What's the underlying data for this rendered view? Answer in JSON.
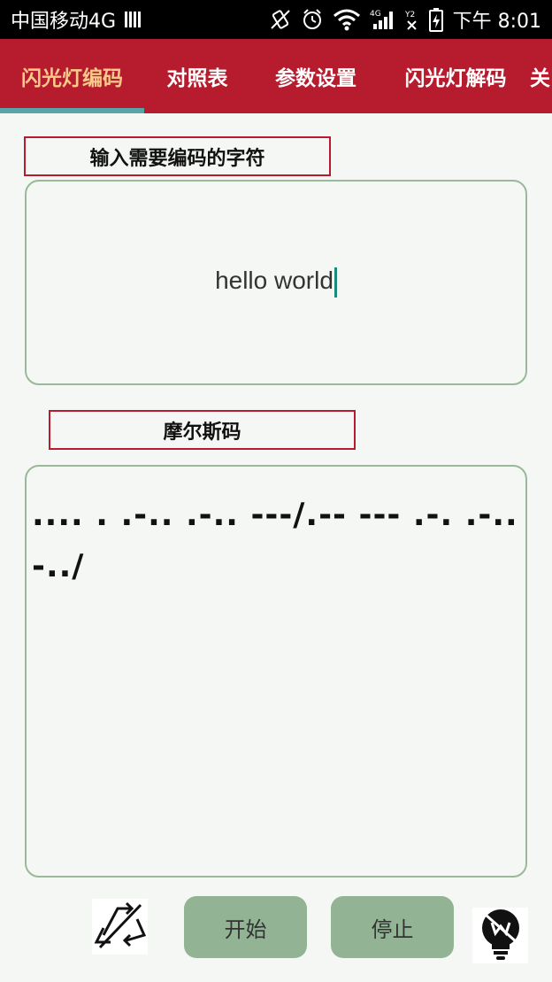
{
  "status_bar": {
    "carrier": "中国移动4G",
    "network": "4G",
    "time": "下午 8:01"
  },
  "tabs": [
    {
      "label": "闪光灯编码",
      "active": true
    },
    {
      "label": "对照表",
      "active": false
    },
    {
      "label": "参数设置",
      "active": false
    },
    {
      "label": "闪光灯解码",
      "active": false
    },
    {
      "label": "关",
      "active": false
    }
  ],
  "input_section": {
    "label": "输入需要编码的字符",
    "value": "hello world"
  },
  "morse_section": {
    "label": "摩尔斯码",
    "value": ".... . .-.. .-.. ---/.-- --- .-. .-.. -../"
  },
  "controls": {
    "start_label": "开始",
    "stop_label": "停止",
    "left_icon": "auto-rotate-off-icon",
    "right_icon": "flashlight-off-icon"
  },
  "colors": {
    "status_bar": "#000000",
    "tab_bar": "#b71c2e",
    "active_tab_text": "#f7c98a",
    "tab_indicator": "#5aa3a8",
    "label_border": "#b71c2e",
    "text_area_border": "#9ab89a",
    "button_bg": "#92b494",
    "background": "#f5f7f4"
  }
}
